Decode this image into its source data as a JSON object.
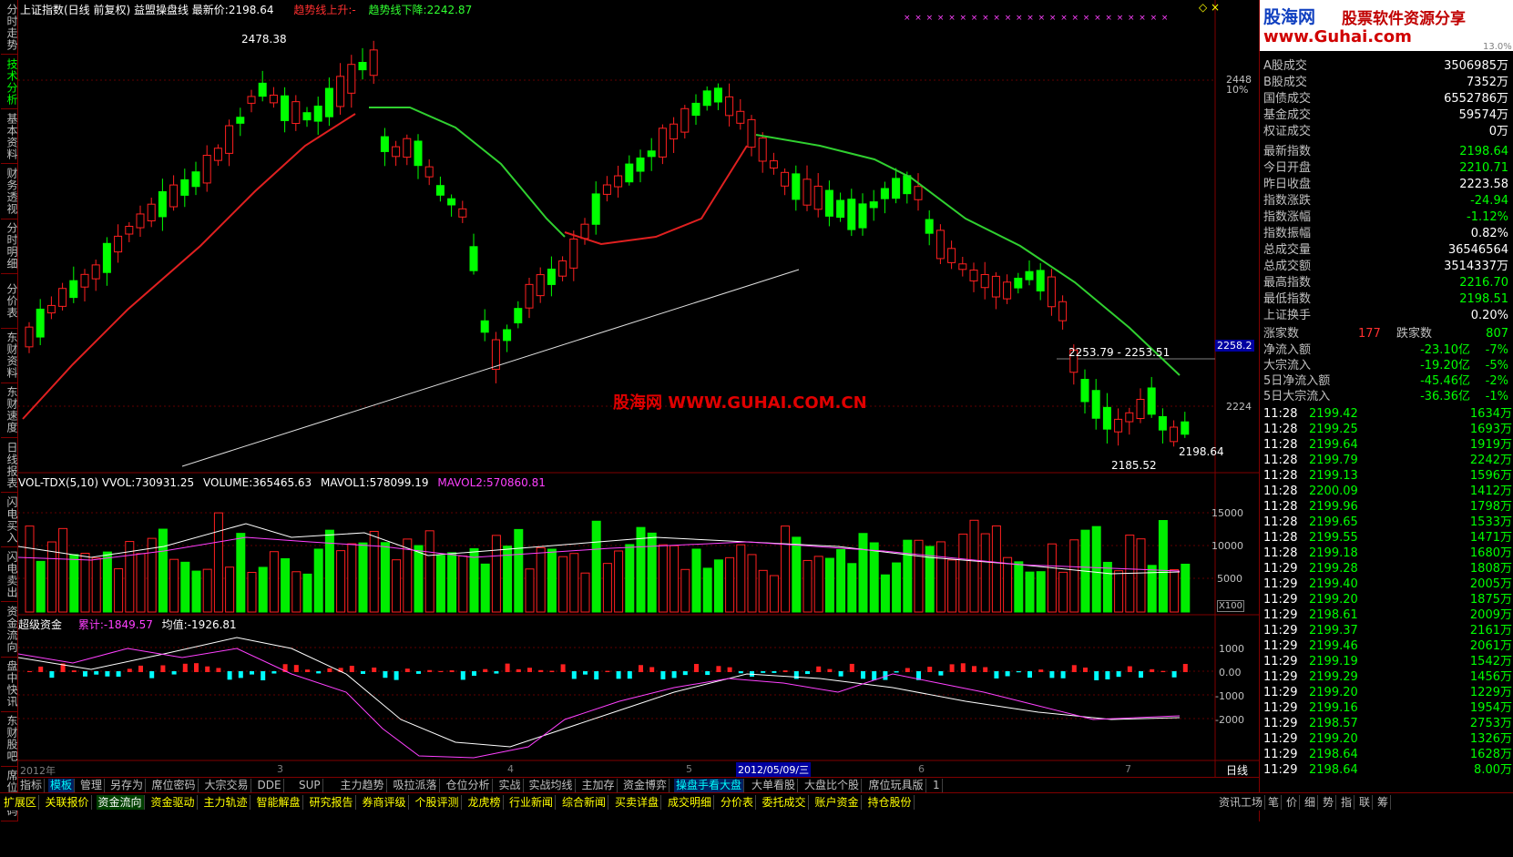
{
  "header": {
    "title": "上证指数(日线 前复权) 益盟操盘线 最新价:",
    "last_price": "2198.64",
    "trend_up_label": "趋势线上升:",
    "trend_up_value": "-",
    "trend_down_label": "趋势线下降:",
    "trend_down_value": "2242.87"
  },
  "sidebar": {
    "tabs": [
      "分时走势",
      "技术分析",
      "基本资料",
      "财务透视",
      "分时明细",
      "分价表",
      "东财资料",
      "东财速度",
      "日线报表",
      "闪电买入",
      "闪电卖出",
      "资金流向",
      "盘中快讯",
      "东财股吧",
      "席位密码"
    ]
  },
  "price_labels": {
    "peak": "2478.38",
    "low": "2185.52",
    "range": "2253.79 - 2253.51",
    "last": "2198.64"
  },
  "price_axis": {
    "ticks": [
      "2448",
      "10%",
      "2224"
    ],
    "current": "2258.2",
    "top_label": "13.0%"
  },
  "volume_header": {
    "title": "VOL-TDX(5,10)",
    "vvol_label": "VVOL:",
    "vvol": "730931.25",
    "volume_label": "VOLUME:",
    "volume": "365465.63",
    "mavol1_label": "MAVOL1:",
    "mavol1": "578099.19",
    "mavol2_label": "MAVOL2:",
    "mavol2": "570860.81"
  },
  "volume_axis": {
    "ticks": [
      "15000",
      "10000",
      "5000"
    ],
    "unit": "X100"
  },
  "fund_header": {
    "title": "超级资金",
    "cum_label": "累计:",
    "cum": "-1849.57",
    "avg_label": "均值:",
    "avg": "-1926.81"
  },
  "fund_axis": {
    "ticks": [
      "1000",
      "0.00",
      "-1000",
      "-2000"
    ]
  },
  "date_axis": {
    "labels": [
      "2012年",
      "3",
      "4",
      "5",
      "6",
      "7"
    ],
    "cursor_date": "2012/05/09/三",
    "period": "日线"
  },
  "watermark": "股海网 WWW.GUHAI.COM.CN",
  "logo": {
    "name": "股海网",
    "slogan": "股票软件资源分享",
    "url": "www.Guhai.com"
  },
  "stats": [
    {
      "k": "A股成交",
      "v": "3506985万"
    },
    {
      "k": "B股成交",
      "v": "7352万"
    },
    {
      "k": "国债成交",
      "v": "6552786万"
    },
    {
      "k": "基金成交",
      "v": "59574万"
    },
    {
      "k": "权证成交",
      "v": "0万"
    }
  ],
  "index_stats": [
    {
      "k": "最新指数",
      "v": "2198.64",
      "c": "#00ff00"
    },
    {
      "k": "今日开盘",
      "v": "2210.71",
      "c": "#00ff00"
    },
    {
      "k": "昨日收盘",
      "v": "2223.58",
      "c": "#ffffff"
    },
    {
      "k": "指数涨跌",
      "v": "-24.94",
      "c": "#00ff00"
    },
    {
      "k": "指数涨幅",
      "v": "-1.12%",
      "c": "#00ff00"
    },
    {
      "k": "指数振幅",
      "v": "0.82%",
      "c": "#ffffff"
    },
    {
      "k": "总成交量",
      "v": "36546564",
      "c": "#ffffff"
    },
    {
      "k": "总成交额",
      "v": "3514337万",
      "c": "#ffffff"
    },
    {
      "k": "最高指数",
      "v": "2216.70",
      "c": "#00ff00"
    },
    {
      "k": "最低指数",
      "v": "2198.51",
      "c": "#00ff00"
    },
    {
      "k": "上证换手",
      "v": "0.20%",
      "c": "#ffffff"
    }
  ],
  "updown": {
    "up_label": "涨家数",
    "up": "177",
    "down_label": "跌家数",
    "down": "807"
  },
  "flows": [
    {
      "k": "净流入额",
      "v": "-23.10亿",
      "p": "-7%"
    },
    {
      "k": "大宗流入",
      "v": "-19.20亿",
      "p": "-5%"
    },
    {
      "k": "5日净流入额",
      "v": "-45.46亿",
      "p": "-2%"
    },
    {
      "k": "5日大宗流入",
      "v": "-36.36亿",
      "p": "-1%"
    }
  ],
  "ticks": [
    {
      "t": "11:28",
      "p": "2199.42",
      "q": "1634万"
    },
    {
      "t": "11:28",
      "p": "2199.25",
      "q": "1693万"
    },
    {
      "t": "11:28",
      "p": "2199.64",
      "q": "1919万"
    },
    {
      "t": "11:28",
      "p": "2199.79",
      "q": "2242万"
    },
    {
      "t": "11:28",
      "p": "2199.13",
      "q": "1596万"
    },
    {
      "t": "11:28",
      "p": "2200.09",
      "q": "1412万"
    },
    {
      "t": "11:28",
      "p": "2199.96",
      "q": "1798万"
    },
    {
      "t": "11:28",
      "p": "2199.65",
      "q": "1533万"
    },
    {
      "t": "11:28",
      "p": "2199.55",
      "q": "1471万"
    },
    {
      "t": "11:28",
      "p": "2199.18",
      "q": "1680万"
    },
    {
      "t": "11:29",
      "p": "2199.28",
      "q": "1808万"
    },
    {
      "t": "11:29",
      "p": "2199.40",
      "q": "2005万"
    },
    {
      "t": "11:29",
      "p": "2199.20",
      "q": "1875万"
    },
    {
      "t": "11:29",
      "p": "2198.61",
      "q": "2009万"
    },
    {
      "t": "11:29",
      "p": "2199.37",
      "q": "2161万"
    },
    {
      "t": "11:29",
      "p": "2199.46",
      "q": "2061万"
    },
    {
      "t": "11:29",
      "p": "2199.19",
      "q": "1542万"
    },
    {
      "t": "11:29",
      "p": "2199.29",
      "q": "1456万"
    },
    {
      "t": "11:29",
      "p": "2199.20",
      "q": "1229万"
    },
    {
      "t": "11:29",
      "p": "2199.16",
      "q": "1954万"
    },
    {
      "t": "11:29",
      "p": "2198.57",
      "q": "2753万"
    },
    {
      "t": "11:29",
      "p": "2199.20",
      "q": "1326万"
    },
    {
      "t": "11:29",
      "p": "2198.64",
      "q": "1628万"
    },
    {
      "t": "11:29",
      "p": "2198.64",
      "q": "8.00万"
    }
  ],
  "toolbar1": [
    "指标",
    "模板",
    "管理",
    "另存为",
    "席位密码",
    "大宗交易",
    "DDE",
    "SUP",
    "主力趋势",
    "吸拉派落",
    "仓位分析",
    "实战",
    "实战均线",
    "主加存",
    "资金博弈",
    "操盘手看大盘",
    "大单看股",
    "大盘比个股",
    "席位玩具版",
    "1"
  ],
  "toolbar2": [
    "扩展区",
    "关联报价",
    "资金流向",
    "资金驱动",
    "主力轨迹",
    "智能解盘",
    "研究报告",
    "券商评级",
    "个股评测",
    "龙虎榜",
    "行业新闻",
    "综合新闻",
    "买卖详盘",
    "成交明细",
    "分价表",
    "委托成交",
    "账户资金",
    "持仓股份"
  ],
  "bottom_right_tabs": [
    "资讯工场",
    "笔",
    "价",
    "细",
    "势",
    "指",
    "联",
    "筹"
  ],
  "colors": {
    "up": "#ff2020",
    "down": "#00ff00",
    "ma_red": "#e02020",
    "ma_green": "#30d030",
    "white": "#ffffff",
    "magenta": "#ff40ff"
  }
}
